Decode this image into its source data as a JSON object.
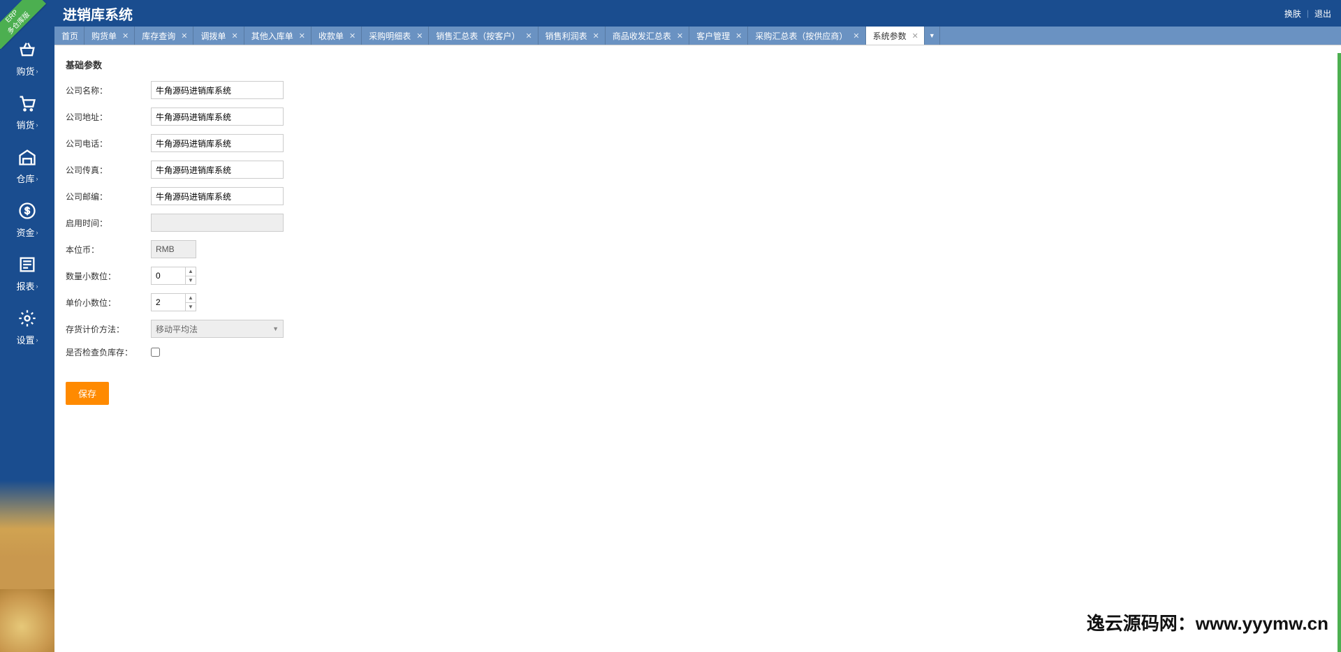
{
  "ribbon": {
    "line1": "ERP",
    "line2": "多仓库版"
  },
  "header": {
    "title": "进销库系统",
    "skin_link": "换肤",
    "logout_link": "退出"
  },
  "sidebar": [
    {
      "icon": "basket",
      "label": "购货"
    },
    {
      "icon": "cart",
      "label": "销货"
    },
    {
      "icon": "warehouse",
      "label": "仓库"
    },
    {
      "icon": "money",
      "label": "资金"
    },
    {
      "icon": "report",
      "label": "报表"
    },
    {
      "icon": "gear",
      "label": "设置"
    }
  ],
  "tabs": [
    {
      "label": "首页",
      "closable": false,
      "active": false
    },
    {
      "label": "购货单",
      "closable": true,
      "active": false
    },
    {
      "label": "库存查询",
      "closable": true,
      "active": false
    },
    {
      "label": "调拨单",
      "closable": true,
      "active": false
    },
    {
      "label": "其他入库单",
      "closable": true,
      "active": false
    },
    {
      "label": "收款单",
      "closable": true,
      "active": false
    },
    {
      "label": "采购明细表",
      "closable": true,
      "active": false
    },
    {
      "label": "销售汇总表（按客户）",
      "closable": true,
      "active": false
    },
    {
      "label": "销售利润表",
      "closable": true,
      "active": false
    },
    {
      "label": "商品收发汇总表",
      "closable": true,
      "active": false
    },
    {
      "label": "客户管理",
      "closable": true,
      "active": false
    },
    {
      "label": "采购汇总表（按供应商）",
      "closable": true,
      "active": false
    },
    {
      "label": "系统参数",
      "closable": true,
      "active": true
    }
  ],
  "form": {
    "section_title": "基础参数",
    "rows": {
      "company_name": {
        "label": "公司名称：",
        "value": "牛角源码进销库系统"
      },
      "company_addr": {
        "label": "公司地址：",
        "value": "牛角源码进销库系统"
      },
      "company_tel": {
        "label": "公司电话：",
        "value": "牛角源码进销库系统"
      },
      "company_fax": {
        "label": "公司传真：",
        "value": "牛角源码进销库系统"
      },
      "company_zip": {
        "label": "公司邮编：",
        "value": "牛角源码进销库系统"
      },
      "start_date": {
        "label": "启用时间：",
        "value": ""
      },
      "currency": {
        "label": "本位币：",
        "value": "RMB"
      },
      "qty_decimal": {
        "label": "数量小数位：",
        "value": "0"
      },
      "price_decimal": {
        "label": "单价小数位：",
        "value": "2"
      },
      "cost_method": {
        "label": "存货计价方法：",
        "value": "移动平均法"
      },
      "check_neg": {
        "label": "是否检查负库存："
      }
    },
    "save_label": "保存"
  },
  "watermark": "逸云源码网：www.yyymw.cn"
}
